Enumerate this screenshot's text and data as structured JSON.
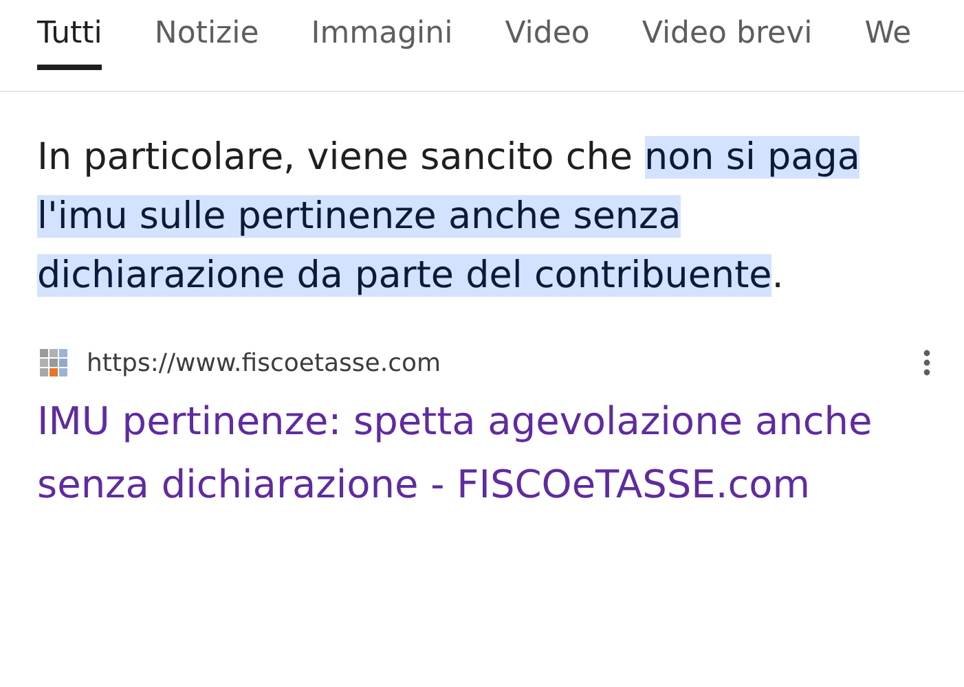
{
  "tabs": [
    {
      "label": "Tutti",
      "selected": true
    },
    {
      "label": "Notizie",
      "selected": false
    },
    {
      "label": "Immagini",
      "selected": false
    },
    {
      "label": "Video",
      "selected": false
    },
    {
      "label": "Video brevi",
      "selected": false
    },
    {
      "label": "We",
      "selected": false
    }
  ],
  "snippet": [
    {
      "text": "In particolare, viene sancito che ",
      "highlighted": false
    },
    {
      "text": "non si paga l'imu sulle pertinenze anche senza dichiarazione da parte del contribuente",
      "highlighted": true
    },
    {
      "text": ".",
      "highlighted": false
    }
  ],
  "result": {
    "url": "https://www.fiscoetasse.com",
    "title": "IMU pertinenze: spetta agevolazione anche senza dichiarazione - FISCOeTASSE.com"
  }
}
